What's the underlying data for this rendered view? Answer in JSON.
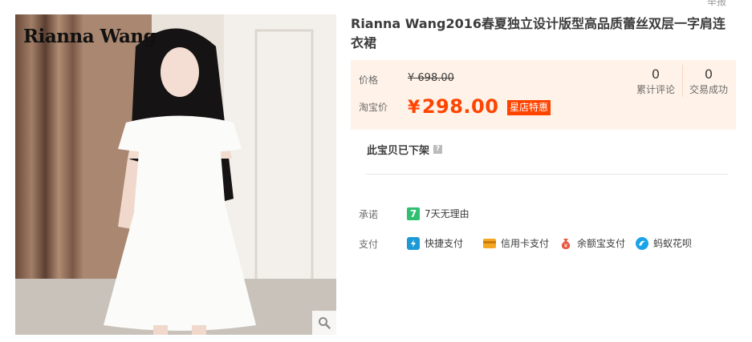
{
  "header": {
    "report_label": "举报"
  },
  "gallery": {
    "brand_logo_text": "Rianna Wang",
    "zoom_icon": "search-icon"
  },
  "product": {
    "title": "Rianna Wang2016春夏独立设计版型高品质蕾丝双层一字肩连衣裙",
    "price_label": "价格",
    "original_price": "¥ 698.00",
    "promo_label": "淘宝价",
    "currency": "¥",
    "promo_price": "298.00",
    "promo_tag": "星店特惠",
    "stats": [
      {
        "value": "0",
        "label": "累计评论"
      },
      {
        "value": "0",
        "label": "交易成功"
      }
    ],
    "status": "此宝贝已下架",
    "status_help": "?"
  },
  "service": {
    "promise_label": "承诺",
    "promise_badge": "7",
    "promise_text": "7天无理由",
    "payment_label": "支付",
    "payments": [
      {
        "label": "快捷支付",
        "icon": "express-pay-icon"
      },
      {
        "label": "信用卡支付",
        "icon": "credit-card-icon"
      },
      {
        "label": "余额宝支付",
        "icon": "yuebao-icon"
      },
      {
        "label": "蚂蚁花呗",
        "icon": "huabei-icon"
      }
    ]
  },
  "colors": {
    "accent": "#ff4400",
    "price_bg": "#fff2e8",
    "promise_green": "#2fbf71"
  }
}
